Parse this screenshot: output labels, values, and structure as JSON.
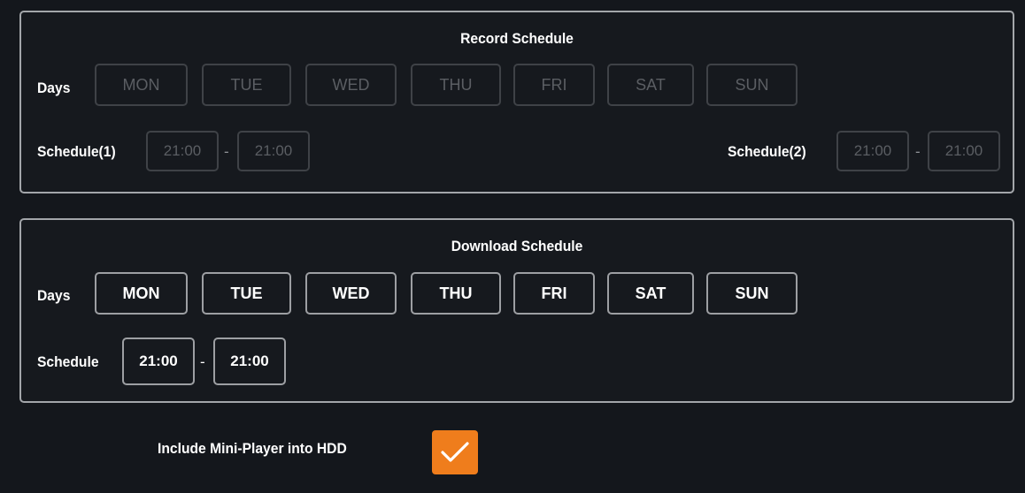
{
  "record_schedule": {
    "title": "Record Schedule",
    "days_label": "Days",
    "days": [
      "MON",
      "TUE",
      "WED",
      "THU",
      "FRI",
      "SAT",
      "SUN"
    ],
    "schedule1_label": "Schedule(1)",
    "schedule1_start": "21:00",
    "schedule1_end": "21:00",
    "schedule2_label": "Schedule(2)",
    "schedule2_start": "21:00",
    "schedule2_end": "21:00",
    "separator": "-"
  },
  "download_schedule": {
    "title": "Download Schedule",
    "days_label": "Days",
    "days": [
      "MON",
      "TUE",
      "WED",
      "THU",
      "FRI",
      "SAT",
      "SUN"
    ],
    "schedule_label": "Schedule",
    "schedule_start": "21:00",
    "schedule_end": "21:00",
    "separator": "-"
  },
  "mini_player": {
    "label": "Include Mini-Player into HDD",
    "checked": true,
    "checkbox_color": "#ef7d1c",
    "check_icon": "checkmark-icon"
  },
  "colors": {
    "background": "#14171c",
    "border_active": "#9d9fa3",
    "border_disabled": "#3f4247",
    "text_disabled": "#5b5e63",
    "accent": "#ef7d1c"
  }
}
